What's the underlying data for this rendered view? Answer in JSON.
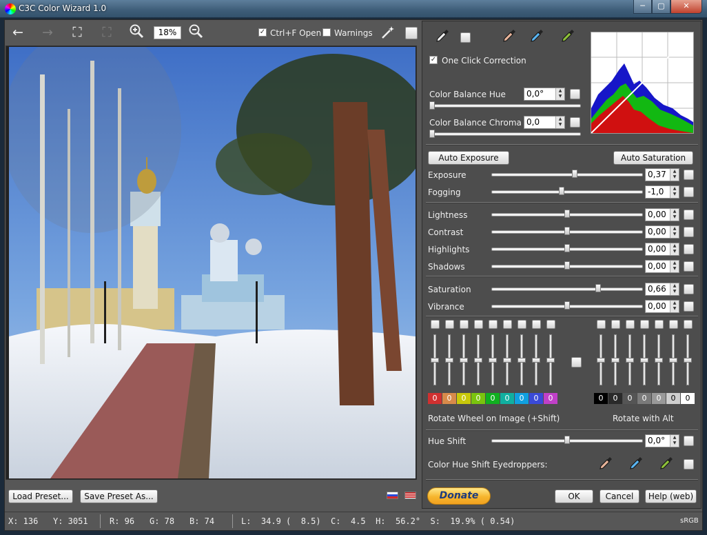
{
  "window": {
    "title": "C3C Color Wizard 1.0",
    "min": "─",
    "max": "▢",
    "close": "✕"
  },
  "toolbar": {
    "zoom": "18%",
    "ctrl_f_label": "Ctrl+F Open",
    "warnings_label": "Warnings",
    "ctrl_f_checked": true,
    "warnings_checked": false
  },
  "eyedropper": {
    "one_click_label": "One Click Correction",
    "one_click_checked": true
  },
  "color_balance": {
    "hue_label": "Color Balance Hue",
    "hue_value": "0,0°",
    "hue_level": 0,
    "chroma_label": "Color Balance Chroma",
    "chroma_value": "0,0",
    "chroma_level": 0
  },
  "auto": {
    "exposure_label": "Auto Exposure",
    "saturation_label": "Auto Saturation"
  },
  "adjust": [
    {
      "label": "Exposure",
      "value": "0,37",
      "level": 0.55
    },
    {
      "label": "Fogging",
      "value": "-1,0",
      "level": 0.46
    },
    {
      "label": "Lightness",
      "value": "0,00",
      "level": 0.5
    },
    {
      "label": "Contrast",
      "value": "0,00",
      "level": 0.5
    },
    {
      "label": "Highlights",
      "value": "0,00",
      "level": 0.5
    },
    {
      "label": "Shadows",
      "value": "0,00",
      "level": 0.5
    },
    {
      "label": "Saturation",
      "value": "0,66",
      "level": 0.71
    },
    {
      "label": "Vibrance",
      "value": "0,00",
      "level": 0.5
    }
  ],
  "hue_chips": [
    {
      "value": "0",
      "color": "#d03030"
    },
    {
      "value": "0",
      "color": "#d88a4a"
    },
    {
      "value": "0",
      "color": "#c8c80a"
    },
    {
      "value": "0",
      "color": "#7ac40e"
    },
    {
      "value": "0",
      "color": "#10b020"
    },
    {
      "value": "0",
      "color": "#10b0a0"
    },
    {
      "value": "0",
      "color": "#10a0e0"
    },
    {
      "value": "0",
      "color": "#3a4ad8"
    },
    {
      "value": "0",
      "color": "#c040c8"
    }
  ],
  "tone_chips": [
    {
      "value": "0",
      "color": "#000000"
    },
    {
      "value": "0",
      "color": "#2a2a2a"
    },
    {
      "value": "0",
      "color": "#555555"
    },
    {
      "value": "0",
      "color": "#7a7a7a"
    },
    {
      "value": "0",
      "color": "#999999"
    },
    {
      "value": "0",
      "color": "#cfcfcf"
    },
    {
      "value": "0",
      "color": "#ffffff"
    }
  ],
  "rotate_wheel_label": "Rotate Wheel on Image (+Shift)",
  "rotate_alt_label": "Rotate with Alt",
  "hue_shift": {
    "label": "Hue Shift",
    "value": "0,0°",
    "level": 0.5
  },
  "eyedroppers_label": "Color Hue Shift Eyedroppers:",
  "buttons": {
    "load_preset": "Load Preset...",
    "save_preset": "Save Preset As...",
    "donate": "Donate",
    "ok": "OK",
    "cancel": "Cancel",
    "help": "Help (web)"
  },
  "status": {
    "x": "X: 136",
    "y": "Y: 3051",
    "r": "R: 96",
    "g": "G: 78",
    "b": "B: 74",
    "lab": "L:  34.9 (  8.5)  C:  4.5  H:  56.2°  S:  19.9% ( 0.54)",
    "profile": "sRGB"
  }
}
